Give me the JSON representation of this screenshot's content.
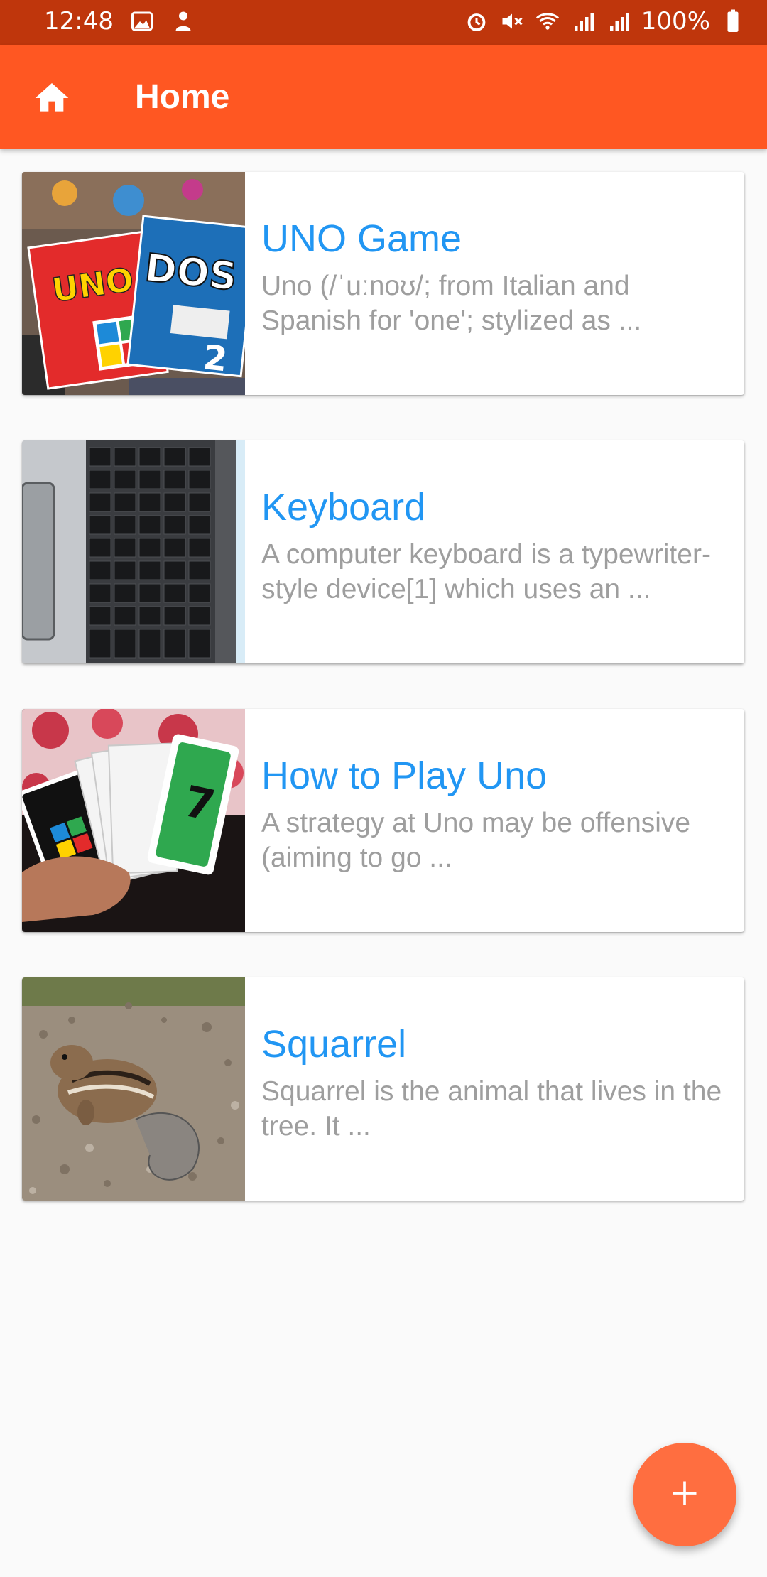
{
  "status_bar": {
    "time": "12:48",
    "battery": "100%",
    "left_icons": [
      "image-icon",
      "notification-icon"
    ],
    "right_icons": [
      "alarm-icon",
      "mute-icon",
      "wifi-icon",
      "signal-icon",
      "signal-icon",
      "battery-icon"
    ]
  },
  "app_bar": {
    "title": "Home",
    "leading_icon": "home-icon"
  },
  "items": [
    {
      "title": "UNO Game",
      "description": "Uno (/ˈuːnoʊ/; from Italian and Spanish for 'one'; stylized as ..."
    },
    {
      "title": "Keyboard",
      "description": "A computer keyboard is a typewriter-style device[1] which uses an ..."
    },
    {
      "title": "How to Play Uno",
      "description": "A strategy at Uno may be offensive (aiming to go ..."
    },
    {
      "title": "Squarrel",
      "description": "Squarrel is the animal that lives in the tree. It ..."
    }
  ],
  "fab": {
    "icon": "plus-icon"
  },
  "colors": {
    "status_bar": "#bf360c",
    "app_bar": "#ff5722",
    "card_title": "#2196f3",
    "card_description": "#9e9e9e",
    "fab": "#ff6e40",
    "background": "#fafafa"
  }
}
